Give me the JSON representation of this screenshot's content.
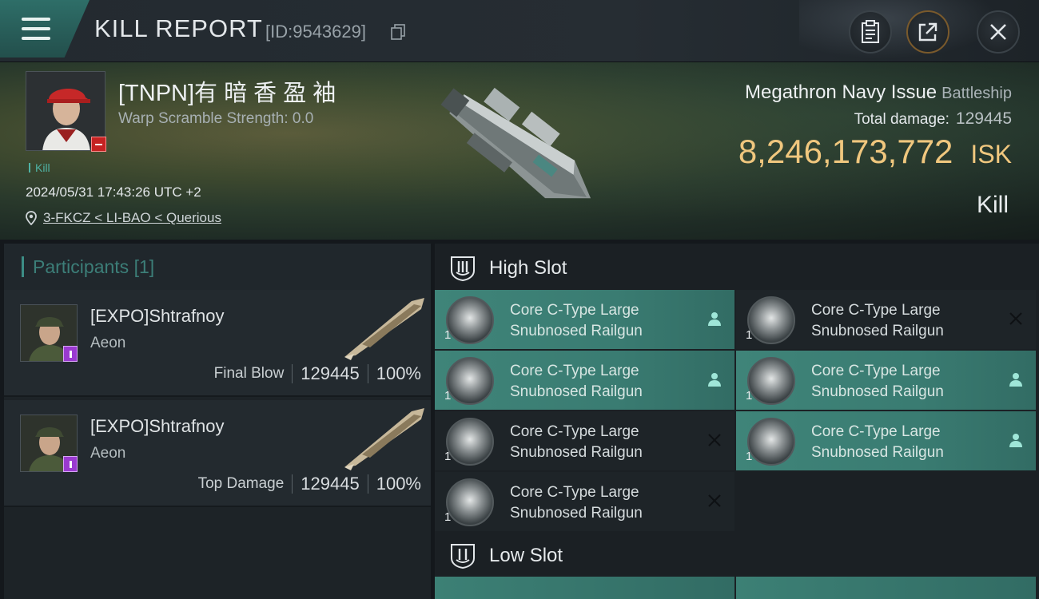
{
  "header": {
    "title": "KILL REPORT",
    "id_text": "[ID:9543629]",
    "buttons": [
      "clipboard-icon",
      "share-icon",
      "close-icon"
    ],
    "accent": "#2e6e68"
  },
  "victim": {
    "name": "[TNPN]有 暗 香 盈 袖",
    "warp_scramble": "Warp Scramble Strength: 0.0",
    "tag": "Kill",
    "datetime": "2024/05/31 17:43:26 UTC +2",
    "location": "3-FKCZ < LI-BAO < Querious"
  },
  "ship": {
    "name": "Megathron Navy Issue",
    "class": "Battleship",
    "total_damage_label": "Total damage:",
    "total_damage": "129445",
    "isk_value": "8,246,173,772",
    "isk_unit": "ISK",
    "result": "Kill",
    "isk_color": "#f0c77e"
  },
  "participants": {
    "heading": "Participants",
    "count": "[1]",
    "list": [
      {
        "name": "[EXPO]Shtrafnoy",
        "ship": "Aeon",
        "role": "Final Blow",
        "damage": "129445",
        "percent": "100%"
      },
      {
        "name": "[EXPO]Shtrafnoy",
        "ship": "Aeon",
        "role": "Top Damage",
        "damage": "129445",
        "percent": "100%"
      }
    ]
  },
  "slots": {
    "high": {
      "label": "High Slot",
      "modules": [
        {
          "line1": "Core C-Type Large",
          "line2": "Snubnosed Railgun",
          "qty": "1",
          "status": "fitted"
        },
        {
          "line1": "Core C-Type Large",
          "line2": "Snubnosed Railgun",
          "qty": "1",
          "status": "destroyed"
        },
        {
          "line1": "Core C-Type Large",
          "line2": "Snubnosed Railgun",
          "qty": "1",
          "status": "fitted"
        },
        {
          "line1": "Core C-Type Large",
          "line2": "Snubnosed Railgun",
          "qty": "1",
          "status": "fitted"
        },
        {
          "line1": "Core C-Type Large",
          "line2": "Snubnosed Railgun",
          "qty": "1",
          "status": "destroyed"
        },
        {
          "line1": "Core C-Type Large",
          "line2": "Snubnosed Railgun",
          "qty": "1",
          "status": "fitted"
        },
        {
          "line1": "Core C-Type Large",
          "line2": "Snubnosed Railgun",
          "qty": "1",
          "status": "destroyed"
        }
      ]
    },
    "low": {
      "label": "Low Slot"
    }
  }
}
